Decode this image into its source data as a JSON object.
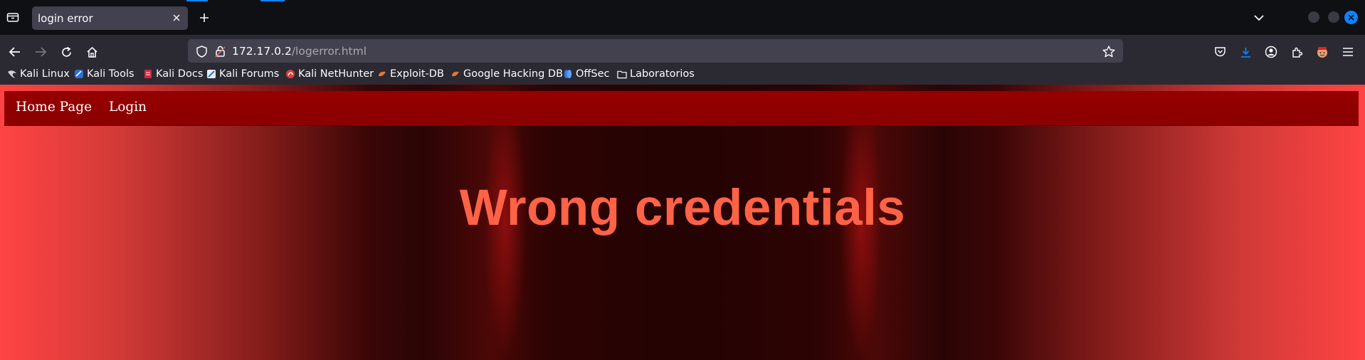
{
  "browser": {
    "tab": {
      "title": "login error"
    },
    "url": {
      "host": "172.17.0.2",
      "path": "/logerror.html"
    },
    "bookmarks": [
      {
        "label": "Kali Linux",
        "icon": "kali-dragon-icon"
      },
      {
        "label": "Kali Tools",
        "icon": "kali-tools-icon"
      },
      {
        "label": "Kali Docs",
        "icon": "kali-docs-icon"
      },
      {
        "label": "Kali Forums",
        "icon": "kali-forums-icon"
      },
      {
        "label": "Kali NetHunter",
        "icon": "kali-nethunter-icon"
      },
      {
        "label": "Exploit-DB",
        "icon": "exploit-db-icon"
      },
      {
        "label": "Google Hacking DB",
        "icon": "ghdb-icon"
      },
      {
        "label": "OffSec",
        "icon": "offsec-icon"
      },
      {
        "label": "Laboratorios",
        "icon": "folder-icon"
      }
    ],
    "colors": {
      "accent": "#0a84ff",
      "toolbar": "#2b2a33",
      "tabbar": "#0f1014"
    }
  },
  "page": {
    "nav": {
      "home_label": "Home Page",
      "login_label": "Login"
    },
    "headline": "Wrong credentials",
    "colors": {
      "nav_bg": "#8b0000",
      "headline": "#ff6347",
      "edge": "#ff4444"
    }
  }
}
